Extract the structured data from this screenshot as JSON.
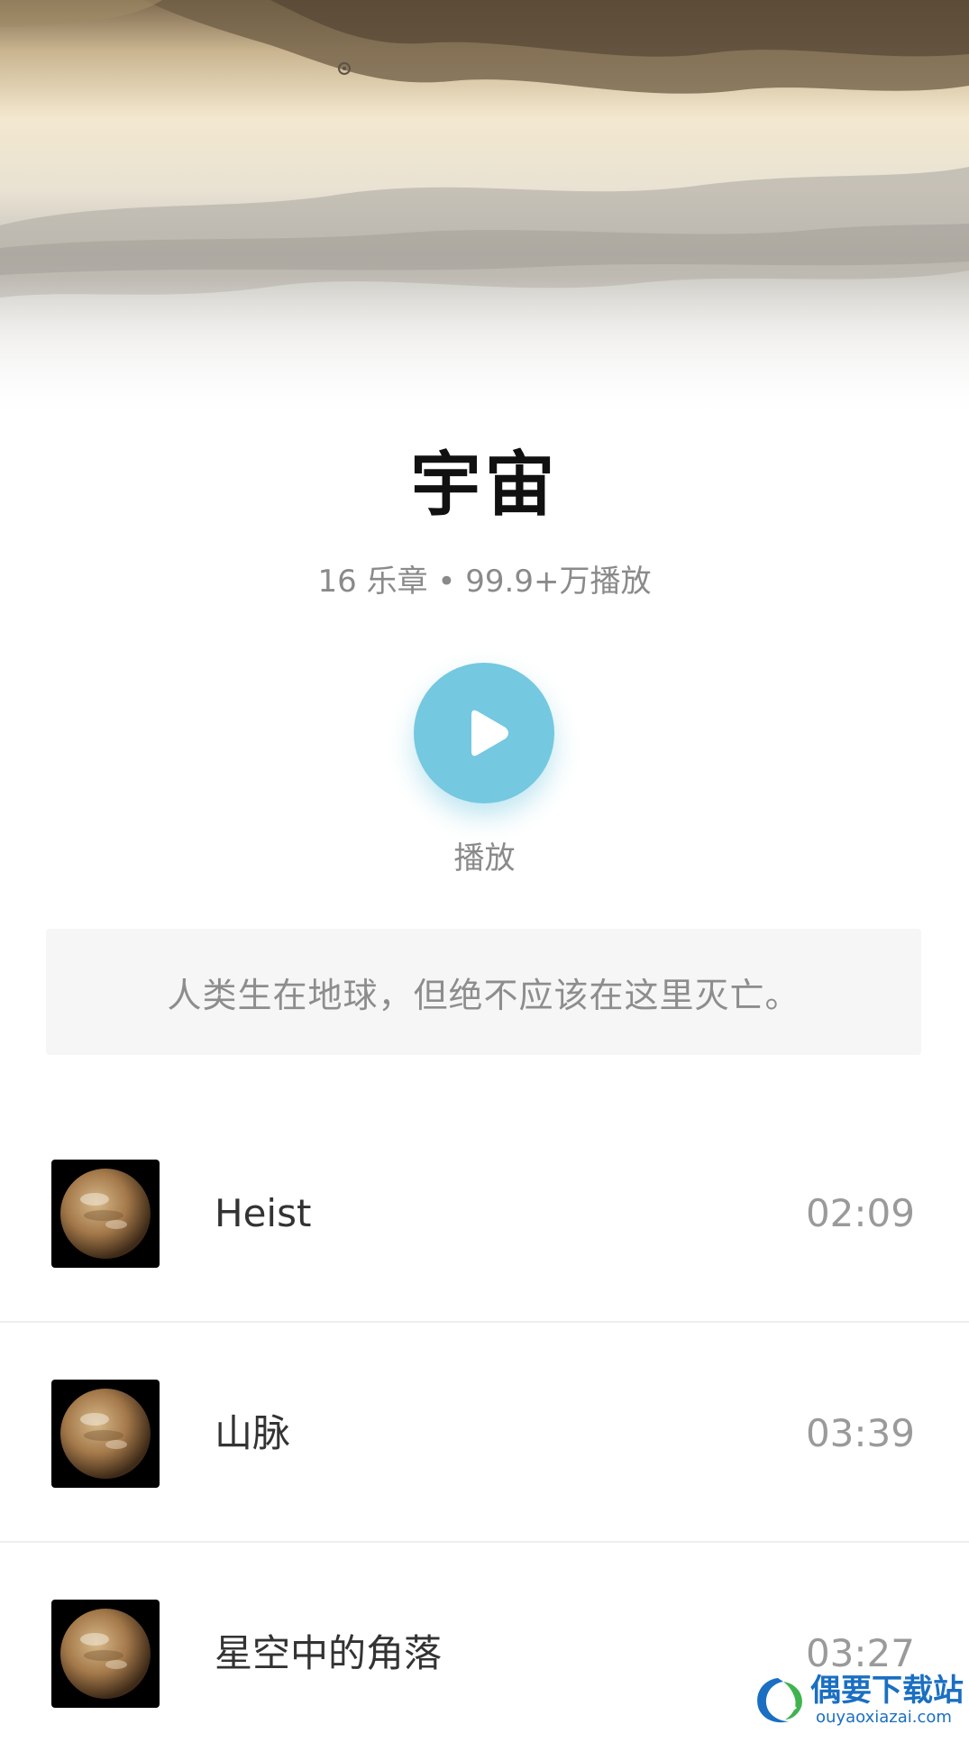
{
  "album": {
    "title": "宇宙",
    "meta": "16 乐章 • 99.9+万播放",
    "play_label": "播放",
    "quote": "人类生在地球，但绝不应该在这里灭亡。"
  },
  "tracks": [
    {
      "name": "Heist",
      "duration": "02:09"
    },
    {
      "name": "山脉",
      "duration": "03:39"
    },
    {
      "name": "星空中的角落",
      "duration": "03:27"
    }
  ],
  "watermark": {
    "title": "偶要下载站",
    "url": "ouyaoxiazai.com"
  },
  "colors": {
    "accent": "#74c8e0",
    "title": "#111111",
    "muted": "#8a8a8a",
    "quote_bg": "#f6f6f6",
    "watermark": "#1a6fc2"
  },
  "icons": {
    "play": "play-icon",
    "cover": "planet-cover-icon",
    "hero": "sky-clouds-banner",
    "settings": "gear-icon"
  }
}
